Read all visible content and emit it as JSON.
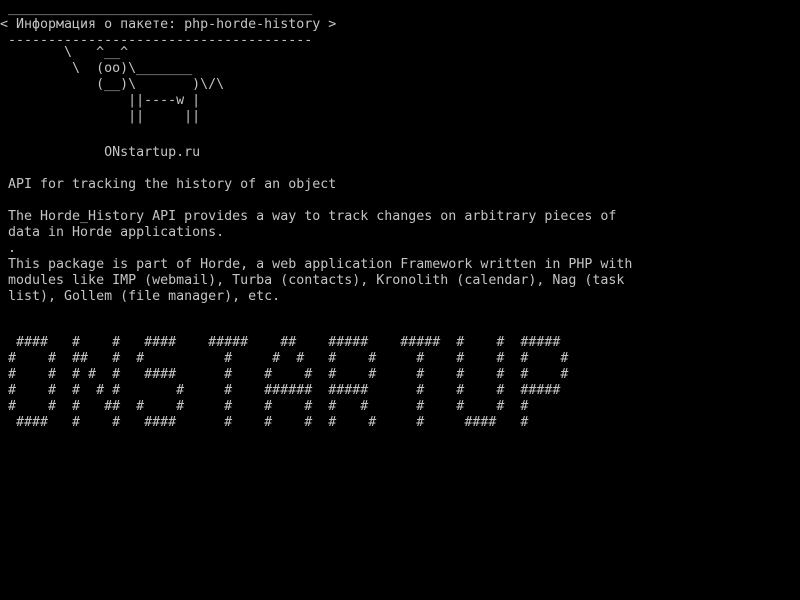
{
  "console": {
    "background": "#000000",
    "text_color": "#c4c4c4"
  },
  "bubble": {
    "top_border": " ______________________________________",
    "message": "< Информация о пакете: php-horde-history >",
    "bottom_border": " --------------------------------------"
  },
  "cow": {
    "lines": [
      "        \\   ^__^",
      "         \\  (oo)\\_______",
      "            (__)\\       )\\/\\",
      "                ||----w |",
      "                ||     ||"
    ]
  },
  "site": {
    "text": "             ONstartup.ru"
  },
  "package": {
    "summary": " API for tracking the history of an object",
    "description_lines": [
      " The Horde_History API provides a way to track changes on arbitrary pieces of",
      " data in Horde applications.",
      " .",
      " This package is part of Horde, a web application Framework written in PHP with",
      " modules like IMP (webmail), Turba (contacts), Kronolith (calendar), Nag (task",
      " list), Gollem (file manager), etc."
    ]
  },
  "banner": {
    "lines": [
      "  ####   #    #   ####    #####    ##    #####    #####  #    #  #####",
      " #    #  ##   #  #          #     #  #   #    #     #    #    #  #    #",
      " #    #  # #  #   ####      #    #    #  #    #     #    #    #  #    #",
      " #    #  #  # #       #     #    ######  #####      #    #    #  #####",
      " #    #  #   ##  #    #     #    #    #  #   #      #    #    #  #",
      "  ####   #    #   ####      #    #    #  #    #     #     ####   #"
    ]
  }
}
